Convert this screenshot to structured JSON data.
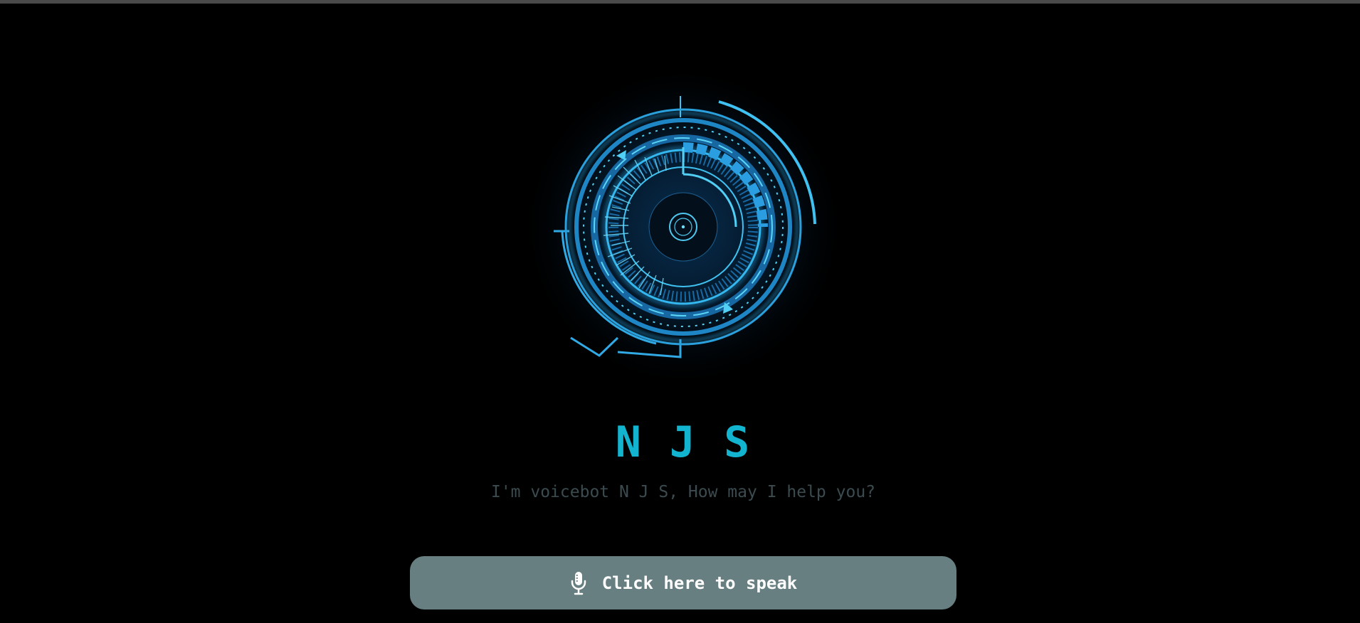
{
  "header": {
    "title": "N J S",
    "subtitle": "I'm voicebot N J S, How may I help you?"
  },
  "hud": {
    "icon": "circular-hud-eye-icon",
    "color": "#2aa8e6"
  },
  "speak_button": {
    "label": "Click here to speak",
    "icon": "microphone-icon",
    "background": "#677f80"
  },
  "colors": {
    "background": "#000000",
    "title": "#12b4d0",
    "subtitle": "#3b4b4f",
    "button_text": "#ffffff"
  }
}
